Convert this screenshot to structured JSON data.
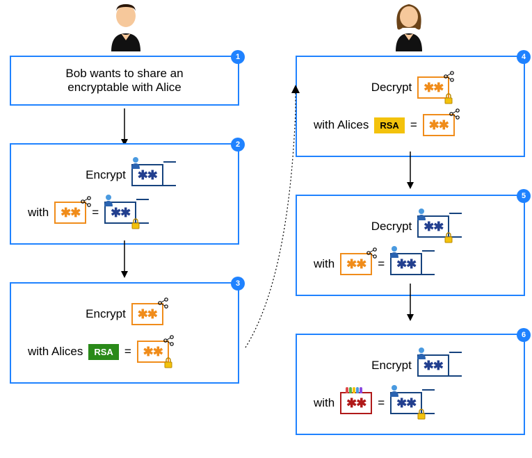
{
  "actors": {
    "bob": "Bob",
    "alice": "Alice"
  },
  "box1": {
    "num": "1",
    "line1": "Bob wants to share an",
    "line2": "encryptable with Alice"
  },
  "box2": {
    "num": "2",
    "encrypt": "Encrypt",
    "with": "with",
    "eq": "="
  },
  "box3": {
    "num": "3",
    "encrypt": "Encrypt",
    "withAlices": "with Alices",
    "rsa": "RSA",
    "eq": "="
  },
  "box4": {
    "num": "4",
    "decrypt": "Decrypt",
    "withAlices": "with Alices",
    "rsa": "RSA",
    "eq": "="
  },
  "box5": {
    "num": "5",
    "decrypt": "Decrypt",
    "with": "with",
    "eq": "="
  },
  "box6": {
    "num": "6",
    "encrypt": "Encrypt",
    "with": "with",
    "eq": "="
  }
}
